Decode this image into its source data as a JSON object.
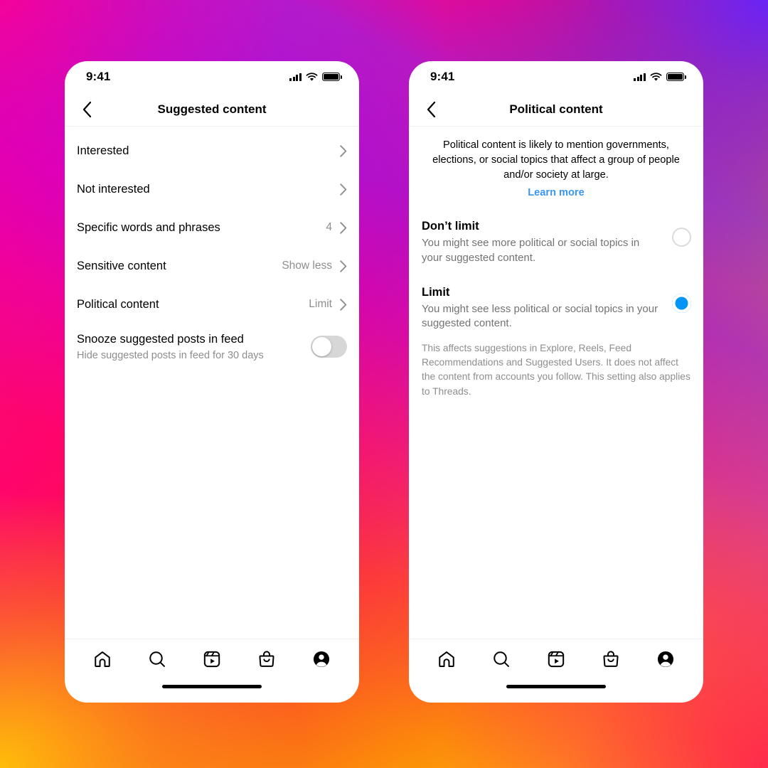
{
  "background": {
    "gradient_colors": [
      "#FF0090",
      "#FA1E4E",
      "#FB7215",
      "#FFDC00",
      "#6E23FF",
      "#C400D6"
    ],
    "description": "Instagram brand gradient"
  },
  "theme": {
    "accent_blue": "#0095f6",
    "link_blue": "#3a96f0",
    "secondary_text": "#8e8e8e",
    "divider": "#f0f0f0",
    "toggle_off_track": "#d7d7d7",
    "radio_off_border": "#dbdbdb"
  },
  "phones": [
    {
      "id": "suggested-content",
      "status_bar": {
        "time": "9:41",
        "signal_icon": "cellular-signal-icon",
        "wifi_icon": "wifi-icon",
        "battery_icon": "battery-full-icon"
      },
      "header": {
        "back_icon": "chevron-left-icon",
        "title": "Suggested content"
      },
      "rows": [
        {
          "label": "Interested",
          "value": "",
          "chevron": "chevron-right-icon"
        },
        {
          "label": "Not interested",
          "value": "",
          "chevron": "chevron-right-icon"
        },
        {
          "label": "Specific words and phrases",
          "value": "4",
          "chevron": "chevron-right-icon"
        },
        {
          "label": "Sensitive content",
          "value": "Show less",
          "chevron": "chevron-right-icon"
        },
        {
          "label": "Political content",
          "value": "Limit",
          "chevron": "chevron-right-icon"
        }
      ],
      "toggle_row": {
        "title": "Snooze suggested posts in feed",
        "subtitle": "Hide suggested posts in feed for 30 days",
        "state": "off"
      }
    },
    {
      "id": "political-content",
      "status_bar": {
        "time": "9:41",
        "signal_icon": "cellular-signal-icon",
        "wifi_icon": "wifi-icon",
        "battery_icon": "battery-full-icon"
      },
      "header": {
        "back_icon": "chevron-left-icon",
        "title": "Political content"
      },
      "intro": {
        "text": "Political content is likely to mention governments, elections, or social topics that affect a group of people and/or society at large.",
        "link": "Learn more"
      },
      "options": [
        {
          "title": "Don’t limit",
          "description": "You might see more political or social topics in your suggested content.",
          "selected": false
        },
        {
          "title": "Limit",
          "description": "You might see less political or social topics in your suggested content.",
          "selected": true
        }
      ],
      "footnote": "This affects suggestions in Explore, Reels, Feed Recommendations and Suggested Users. It does not affect the content from accounts you follow. This setting also applies to Threads."
    }
  ],
  "tabbar": {
    "items": [
      {
        "name": "home-icon",
        "label": "Home"
      },
      {
        "name": "search-icon",
        "label": "Search"
      },
      {
        "name": "reels-icon",
        "label": "Reels"
      },
      {
        "name": "shop-icon",
        "label": "Shop"
      },
      {
        "name": "profile-icon",
        "label": "Profile"
      }
    ]
  }
}
